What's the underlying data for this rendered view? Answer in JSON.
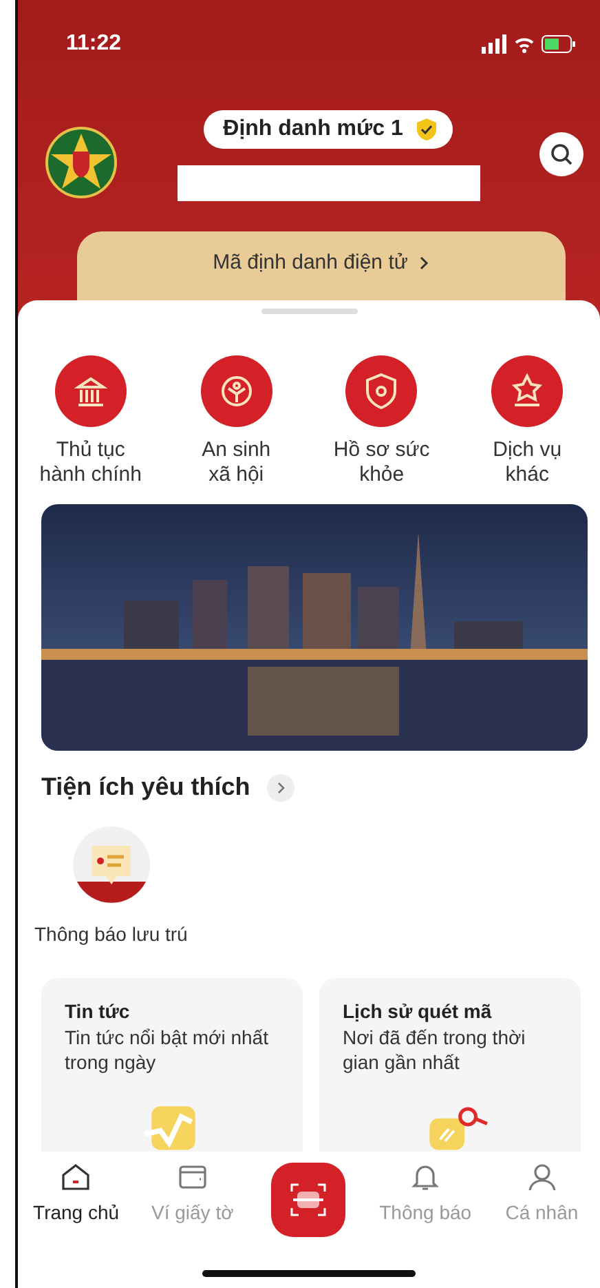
{
  "status_bar": {
    "time": "11:22"
  },
  "header": {
    "level_badge": "Định danh mức 1"
  },
  "id_card": {
    "title": "Mã định danh điện tử"
  },
  "services": [
    {
      "label": "Thủ tục\nhành chính"
    },
    {
      "label": "An sinh\nxã hội"
    },
    {
      "label": "Hồ sơ sức\nkhỏe"
    },
    {
      "label": "Dịch vụ\nkhác"
    }
  ],
  "favorites": {
    "title": "Tiện ích yêu thích",
    "items": [
      {
        "label": "Thông báo lưu trú"
      }
    ]
  },
  "cards": [
    {
      "title": "Tin tức",
      "subtitle": "Tin tức nổi bật mới nhất trong ngày"
    },
    {
      "title": "Lịch sử quét mã",
      "subtitle": "Nơi đã đến trong thời gian gần nhất"
    }
  ],
  "nav": [
    {
      "kind": "tab",
      "label": "Trang chủ",
      "selected": true
    },
    {
      "kind": "tab",
      "label": "Ví giấy tờ",
      "selected": false
    },
    {
      "kind": "scan"
    },
    {
      "kind": "tab",
      "label": "Thông báo",
      "selected": false
    },
    {
      "kind": "tab",
      "label": "Cá nhân",
      "selected": false
    }
  ]
}
